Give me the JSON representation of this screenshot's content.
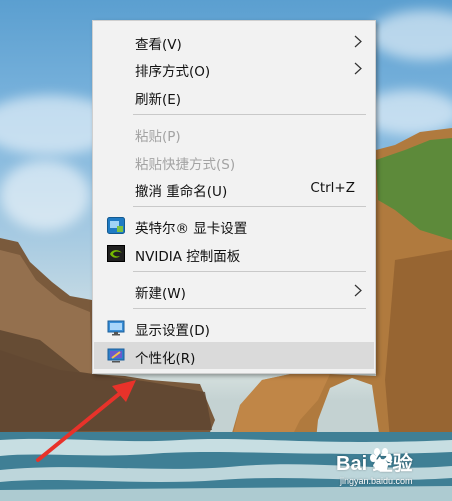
{
  "context_menu": {
    "items": [
      {
        "label": "查看(V)",
        "submenu": true
      },
      {
        "label": "排序方式(O)",
        "submenu": true
      },
      {
        "label": "刷新(E)"
      },
      {
        "label": "粘贴(P)",
        "disabled": true
      },
      {
        "label": "粘贴快捷方式(S)",
        "disabled": true
      },
      {
        "label": "撤消 重命名(U)",
        "shortcut": "Ctrl+Z"
      },
      {
        "label": "英特尔® 显卡设置",
        "icon": "intel-graphics-icon"
      },
      {
        "label": "NVIDIA 控制面板",
        "icon": "nvidia-icon"
      },
      {
        "label": "新建(W)",
        "submenu": true
      },
      {
        "label": "显示设置(D)",
        "icon": "display-settings-icon"
      },
      {
        "label": "个性化(R)",
        "icon": "personalize-icon",
        "highlighted": true
      }
    ]
  },
  "watermark": {
    "logo_text": "Bai  经验",
    "url": "jingyan.baidu.com"
  },
  "colors": {
    "menu_bg": "#f2f2f2",
    "highlight": "#dadada",
    "disabled_text": "#a3a3a3",
    "arrow": "#e8322a"
  }
}
